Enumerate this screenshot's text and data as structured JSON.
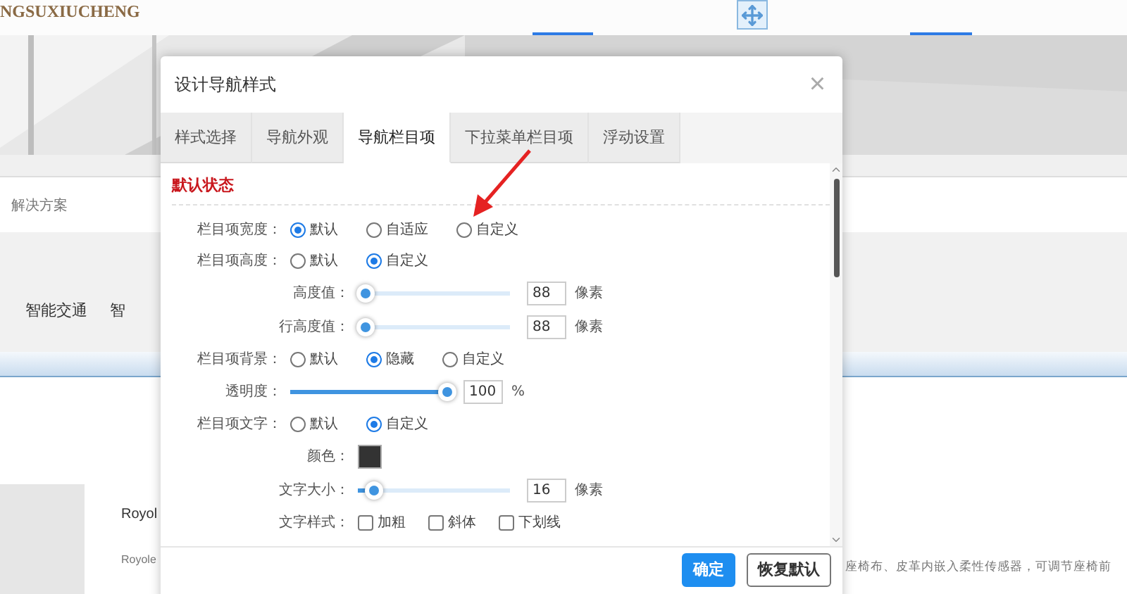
{
  "site": {
    "logo": "NGSUXIUCHENG",
    "breadcrumb": "解决方案",
    "category_tabs": [
      "智能交通",
      "智"
    ],
    "product": {
      "title": "Royol",
      "subtitle": "Royole",
      "description": "座椅布、皮革内嵌入柔性传感器，可调节座椅前"
    }
  },
  "dialog": {
    "title": "设计导航样式",
    "close": "×",
    "tabs": [
      {
        "label": "样式选择",
        "selected": false
      },
      {
        "label": "导航外观",
        "selected": false
      },
      {
        "label": "导航栏目项",
        "selected": true
      },
      {
        "label": "下拉菜单栏目项",
        "selected": false
      },
      {
        "label": "浮动设置",
        "selected": false
      }
    ],
    "section_title": "默认状态",
    "rows": [
      {
        "kind": "radio",
        "nested": false,
        "label": "栏目项宽度：",
        "options": [
          {
            "label": "默认",
            "selected": true
          },
          {
            "label": "自适应",
            "selected": false
          },
          {
            "label": "自定义",
            "selected": false
          }
        ]
      },
      {
        "kind": "radio",
        "nested": false,
        "label": "栏目项高度：",
        "options": [
          {
            "label": "默认",
            "selected": false
          },
          {
            "label": "自定义",
            "selected": true
          }
        ]
      },
      {
        "kind": "slider",
        "nested": true,
        "label": "高度值：",
        "level": 0.05,
        "value": "88",
        "unit": "像素"
      },
      {
        "kind": "slider",
        "nested": true,
        "label": "行高度值：",
        "level": 0.05,
        "value": "88",
        "unit": "像素"
      },
      {
        "kind": "radio",
        "nested": false,
        "label": "栏目项背景：",
        "options": [
          {
            "label": "默认",
            "selected": false
          },
          {
            "label": "隐藏",
            "selected": true
          },
          {
            "label": "自定义",
            "selected": false
          }
        ]
      },
      {
        "kind": "slider",
        "nested": false,
        "label": "透明度：",
        "level": 1,
        "value": "100",
        "unit": "%"
      },
      {
        "kind": "radio",
        "nested": false,
        "label": "栏目项文字：",
        "options": [
          {
            "label": "默认",
            "selected": false
          },
          {
            "label": "自定义",
            "selected": true
          }
        ]
      },
      {
        "kind": "color",
        "nested": true,
        "label": "颜色：",
        "color": "#333333"
      },
      {
        "kind": "slider",
        "nested": true,
        "label": "文字大小：",
        "level": 0.1,
        "value": "16",
        "unit": "像素"
      },
      {
        "kind": "checks",
        "nested": true,
        "label": "文字样式：",
        "options": [
          {
            "label": "加粗",
            "checked": false
          },
          {
            "label": "斜体",
            "checked": false
          },
          {
            "label": "下划线",
            "checked": false
          }
        ]
      }
    ],
    "buttons": [
      {
        "label": "确定",
        "kind": "primary"
      },
      {
        "label": "恢复默认",
        "kind": "default"
      }
    ]
  }
}
